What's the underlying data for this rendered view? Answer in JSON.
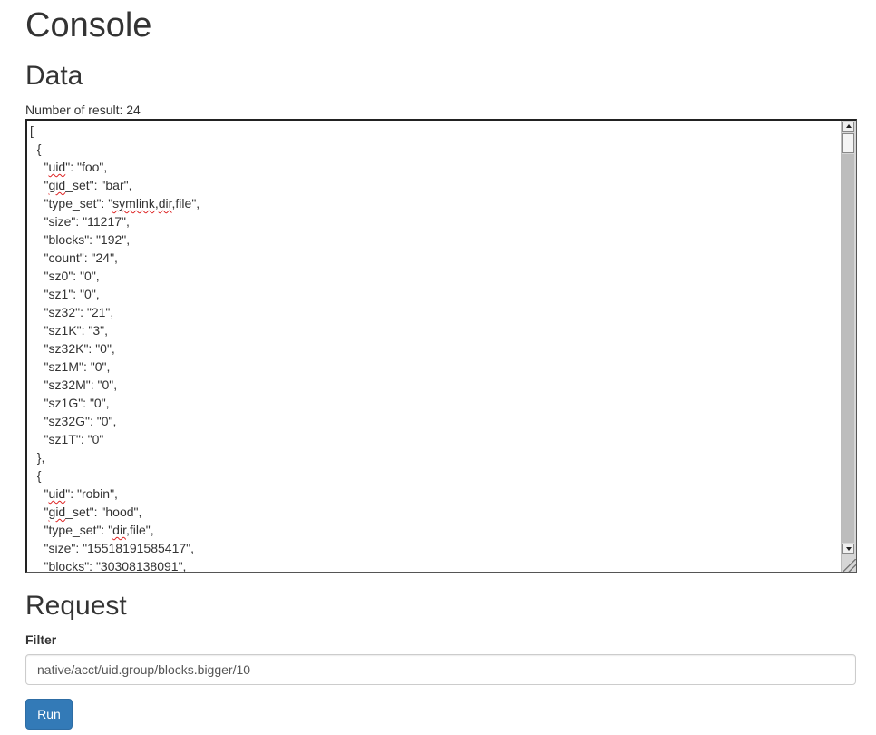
{
  "page": {
    "title": "Console"
  },
  "data_section": {
    "heading": "Data",
    "result_count_text": "Number of result: 24",
    "json_lines": [
      "[",
      "  {",
      "    \"uid\": \"foo\",",
      "    \"gid_set\": \"bar\",",
      "    \"type_set\": \"symlink,dir,file\",",
      "    \"size\": \"11217\",",
      "    \"blocks\": \"192\",",
      "    \"count\": \"24\",",
      "    \"sz0\": \"0\",",
      "    \"sz1\": \"0\",",
      "    \"sz32\": \"21\",",
      "    \"sz1K\": \"3\",",
      "    \"sz32K\": \"0\",",
      "    \"sz1M\": \"0\",",
      "    \"sz32M\": \"0\",",
      "    \"sz1G\": \"0\",",
      "    \"sz32G\": \"0\",",
      "    \"sz1T\": \"0\"",
      "  },",
      "  {",
      "    \"uid\": \"robin\",",
      "    \"gid_set\": \"hood\",",
      "    \"type_set\": \"dir,file\",",
      "    \"size\": \"15518191585417\",",
      "    \"blocks\": \"30308138091\","
    ]
  },
  "request_section": {
    "heading": "Request",
    "filter_label": "Filter",
    "filter_value": "native/acct/uid.group/blocks.bigger/10",
    "run_label": "Run"
  },
  "colors": {
    "primary_button": "#337ab7",
    "spellcheck_underline": "#dd2222"
  }
}
